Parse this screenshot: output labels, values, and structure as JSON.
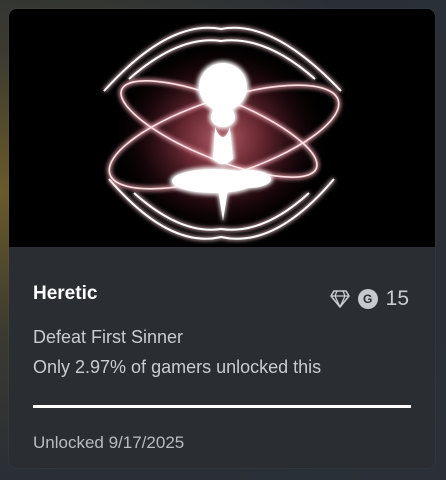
{
  "achievement": {
    "title": "Heretic",
    "gamerscore": "15",
    "gamerscore_badge": "G",
    "description": "Defeat First Sinner",
    "rarity_text": "Only 2.97% of gamers unlocked this",
    "progress_fraction": 1.0,
    "unlocked_text": "Unlocked 9/17/2025"
  },
  "icons": {
    "rarity": "diamond-icon",
    "gamerscore": "gamerscore-g-icon"
  },
  "colors": {
    "art_glow": "#e8808c",
    "progress_fill": "#ffffff",
    "card_bg": "#2a2e33"
  }
}
